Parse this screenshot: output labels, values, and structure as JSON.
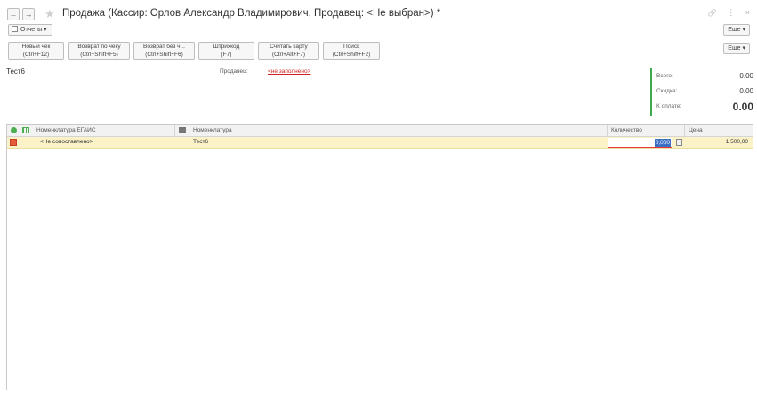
{
  "window": {
    "title": "Продажа (Кассир: Орлов Александр Владимирович, Продавец: <Не выбран>) *",
    "back_glyph": "←",
    "forward_glyph": "→",
    "star_glyph": "★",
    "link_glyph": "🔗",
    "menu_glyph": "⋮",
    "close_glyph": "×"
  },
  "toolbar": {
    "reports_label": "Отчеты",
    "more_label": "Еще"
  },
  "commands": [
    {
      "line1": "Новый чек",
      "line2": "(Ctrl+F12)"
    },
    {
      "line1": "Возврат по чеку",
      "line2": "(Ctrl+Shift+F5)"
    },
    {
      "line1": "Возврат без ч...",
      "line2": "(Ctrl+Shift+F6)"
    },
    {
      "line1": "Штрихкод",
      "line2": "(F7)"
    },
    {
      "line1": "Считать карту",
      "line2": "(Ctrl+Alt+F7)"
    },
    {
      "line1": "Поиск",
      "line2": "(Ctrl+Shift+F2)"
    }
  ],
  "commands_more_label": "Еще",
  "header": {
    "doc_label": "Тест6",
    "seller_label": "Продавец:",
    "seller_value": "<не заполнено>"
  },
  "totals": {
    "total_label": "Всего:",
    "total_value": "0.00",
    "discount_label": "Скидка:",
    "discount_value": "0.00",
    "to_pay_label": "К оплате:",
    "to_pay_value": "0.00"
  },
  "table": {
    "columns": {
      "egais": "Номенклатура ЕГАИС",
      "nomenclature": "Номенклатура",
      "quantity": "Количество",
      "price": "Цена"
    },
    "rows": [
      {
        "egais": "<Не сопоставлено>",
        "nomenclature": "Тест6",
        "quantity": "0,000",
        "price": "1 500,00"
      }
    ]
  },
  "colors": {
    "accent_green": "#3daa4e",
    "row_highlight": "#fbf2c8",
    "error_red": "#d02020",
    "selection_blue": "#3a6fc4"
  }
}
